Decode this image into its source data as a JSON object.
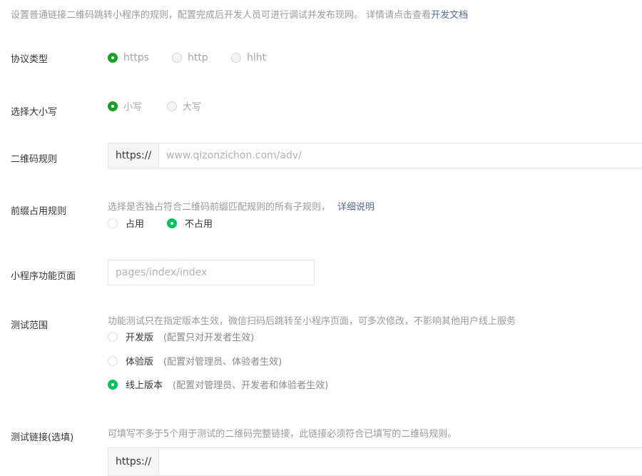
{
  "intro": {
    "text": "设置普通链接二维码跳转小程序的规则，配置完成后开发人员可进行调试并发布现网。 详情请点击查看",
    "link": "开发文档"
  },
  "protocol": {
    "label": "协议类型",
    "options": [
      "https",
      "http",
      "hlht"
    ],
    "selected": "https"
  },
  "case": {
    "label": "选择大小写",
    "options": [
      "小写",
      "大写"
    ],
    "selected": "小写"
  },
  "qr_rule": {
    "label": "二维码规则",
    "prefix": "https://",
    "placeholder": "www.qizonzichon.com/adv/"
  },
  "prefix_rule": {
    "label": "前缀占用规则",
    "desc": "选择是否独占符合二维码前缀匹配规则的所有子规则，",
    "link": "详细说明",
    "options": [
      "占用",
      "不占用"
    ],
    "selected": "不占用"
  },
  "page": {
    "label": "小程序功能页面",
    "placeholder": "pages/index/index"
  },
  "test_scope": {
    "label": "测试范围",
    "desc": "功能测试只在指定版本生效，微信扫码后跳转至小程序页面，可多次修改，不影响其他用户线上服务",
    "options": [
      {
        "name": "开发版",
        "hint": "(配置只对开发者生效)"
      },
      {
        "name": "体验版",
        "hint": "(配置对管理员、体验者生效)"
      },
      {
        "name": "线上版本",
        "hint": "(配置对管理员、开发者和体验者生效)"
      }
    ],
    "selected": "线上版本"
  },
  "test_link": {
    "label": "测试链接(选填)",
    "desc": "可填写不多于5个用于测试的二维码完整链接，此链接必须符合已填写的二维码规则。",
    "prefix": "https://"
  },
  "colors": {
    "radio_selected_dark": "#1a9f29",
    "radio_selected_bright": "#07c160",
    "link": "#576b95"
  }
}
